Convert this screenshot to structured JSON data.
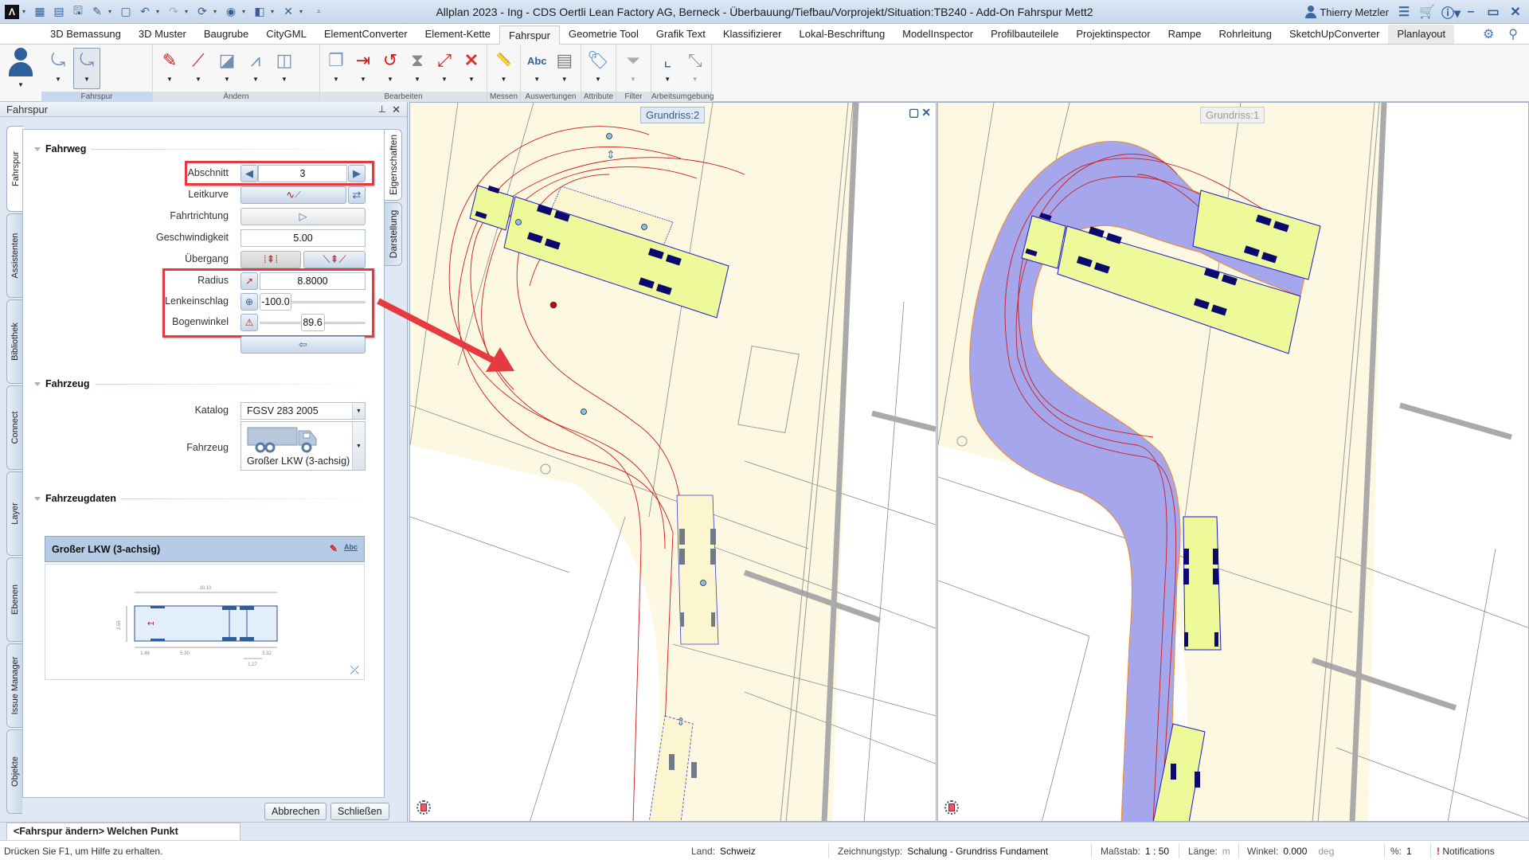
{
  "window": {
    "title": "Allplan 2023 - Ing - CDS Oertli Lean Factory AG, Berneck - Überbauung/Tiefbau/Vorprojekt/Situation:TB240 - Add-On Fahrspur Mett2",
    "user": "Thierry Metzler"
  },
  "tabs": [
    {
      "label": "3D Bemassung"
    },
    {
      "label": "3D Muster"
    },
    {
      "label": "Baugrube"
    },
    {
      "label": "CityGML"
    },
    {
      "label": "ElementConverter"
    },
    {
      "label": "Element-Kette"
    },
    {
      "label": "Fahrspur",
      "active": true
    },
    {
      "label": "Geometrie Tool"
    },
    {
      "label": "Grafik Text"
    },
    {
      "label": "Klassifizierer"
    },
    {
      "label": "Lokal-Beschriftung"
    },
    {
      "label": "ModelInspector"
    },
    {
      "label": "Profilbauteilele"
    },
    {
      "label": "Projektinspector"
    },
    {
      "label": "Rampe"
    },
    {
      "label": "Rohrleitung"
    },
    {
      "label": "SketchUpConverter"
    },
    {
      "label": "Planlayout"
    }
  ],
  "ribbon": {
    "groups": [
      {
        "label": "Fahrspur",
        "buttons": [
          "fahrspur-create-icon",
          "fahrspur-modify-icon"
        ]
      },
      {
        "label": "Ändern",
        "buttons": [
          "pencil-icon",
          "line-modify-icon",
          "edit-area-icon",
          "curve-modify-icon",
          "split-icon"
        ]
      },
      {
        "label": "Bearbeiten",
        "buttons": [
          "copy-icon",
          "move-icon",
          "rotate-icon",
          "mirror-icon",
          "scale-icon",
          "delete-icon"
        ]
      },
      {
        "label": "Messen",
        "buttons": [
          "ruler-icon"
        ]
      },
      {
        "label": "Auswertungen",
        "buttons": [
          "text-abc-icon",
          "report-icon"
        ]
      },
      {
        "label": "Attribute",
        "buttons": [
          "tag-icon"
        ]
      },
      {
        "label": "Filter",
        "buttons": [
          "filter-icon"
        ]
      },
      {
        "label": "Arbeitsumgebung",
        "buttons": [
          "coordinate-icon",
          "zoom-extents-icon"
        ]
      }
    ]
  },
  "panel": {
    "title": "Fahrspur",
    "left_tabs": [
      "Fahrspur",
      "Assistenten",
      "Bibliothek",
      "Connect",
      "Layer",
      "Ebenen",
      "Issue Manager",
      "Objekte"
    ],
    "right_tabs": [
      "Eigenschaften",
      "Darstellung"
    ],
    "fahrweg": {
      "title": "Fahrweg",
      "abschnitt_label": "Abschnitt",
      "abschnitt_value": "3",
      "leitkurve_label": "Leitkurve",
      "fahrtrichtung_label": "Fahrtrichtung",
      "geschwindigkeit_label": "Geschwindigkeit",
      "geschwindigkeit_value": "5.00",
      "uebergang_label": "Übergang",
      "radius_label": "Radius",
      "radius_value": "8.8000",
      "lenkeinschlag_label": "Lenkeinschlag",
      "lenkeinschlag_value": "-100.0",
      "lenkeinschlag_fraction": 0.0,
      "bogenwinkel_label": "Bogenwinkel",
      "bogenwinkel_value": "89.6",
      "bogenwinkel_fraction": 0.5
    },
    "fahrzeug": {
      "title": "Fahrzeug",
      "katalog_label": "Katalog",
      "katalog_value": "FGSV 283 2005",
      "fahrzeug_label": "Fahrzeug",
      "fahrzeug_value": "Großer LKW (3-achsig)"
    },
    "fahrzeugdaten": {
      "title": "Fahrzeugdaten",
      "vehicle_name": "Großer LKW (3-achsig)",
      "dims": {
        "length": "10.10",
        "width": "2.55",
        "front_overhang": "1.48",
        "wheelbase": "5.30",
        "axle_spacing": "1.27",
        "rear_overhang": "3.32"
      }
    },
    "buttons": {
      "cancel": "Abbrechen",
      "close": "Schließen"
    }
  },
  "viewports": {
    "left": {
      "label": "Grundriss:2"
    },
    "right": {
      "label": "Grundriss:1"
    }
  },
  "command_prompt": "<Fahrspur ändern> Welchen Punkt verschieben?",
  "status": {
    "help": "Drücken Sie F1, um Hilfe zu erhalten.",
    "land_label": "Land:",
    "land_value": "Schweiz",
    "zeichnungstyp_label": "Zeichnungstyp:",
    "zeichnungstyp_value": "Schalung  -  Grundriss Fundament",
    "massstab_label": "Maßstab:",
    "massstab_value": "1 : 50",
    "laenge_label": "Länge:",
    "laenge_unit": "m",
    "winkel_label": "Winkel:",
    "winkel_value": "0.000",
    "winkel_unit": "deg",
    "percent_label": "%:",
    "percent_value": "1",
    "notifications": "Notifications"
  },
  "colors": {
    "highlight_box": "#e53a3f",
    "swept_path": "#a5a6ec",
    "vehicle_fill": "#eef99a",
    "vehicle_outline": "#1a1ad0",
    "wheel": "#0a0a6e",
    "track_line": "#d01818",
    "background_area": "#fdf8e2"
  }
}
